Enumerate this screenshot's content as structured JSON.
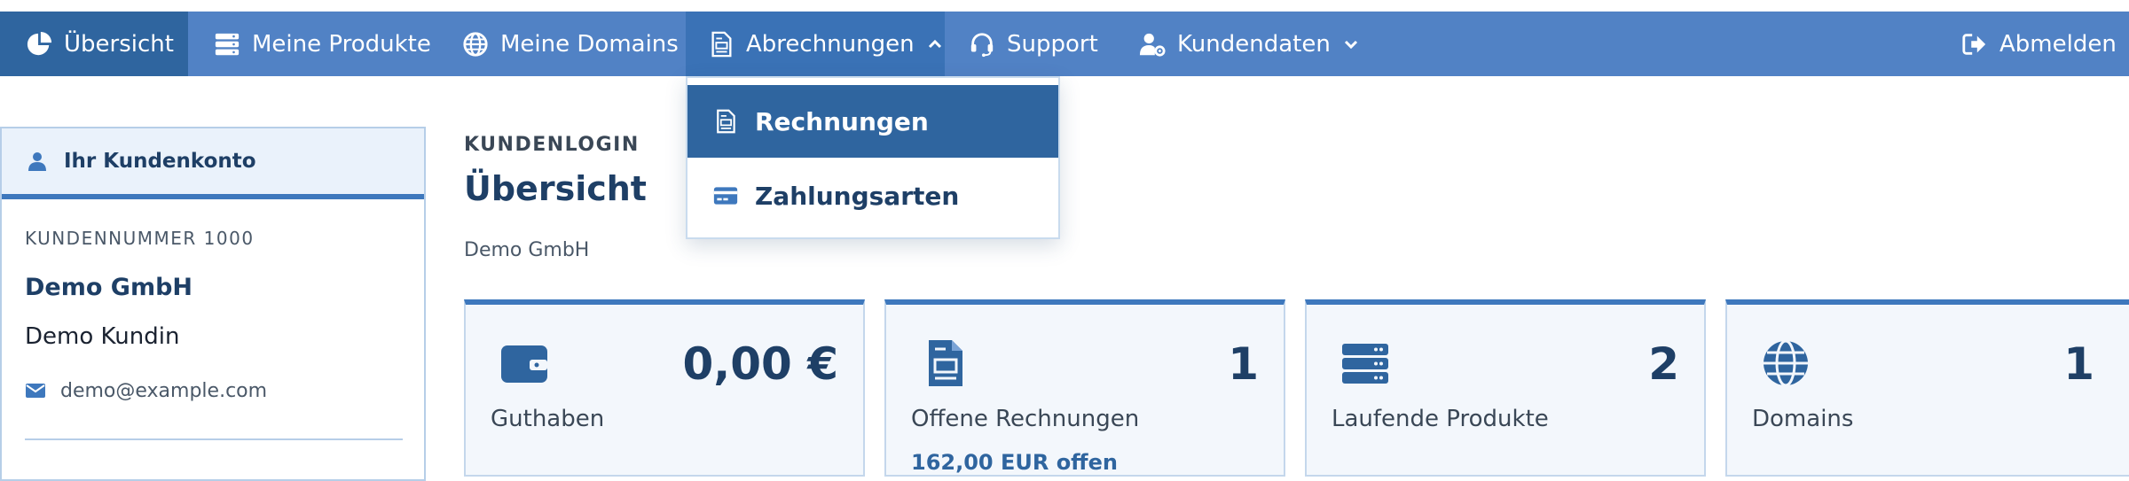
{
  "colors": {
    "nav_bg": "#5182c5",
    "nav_active": "#2f659f",
    "accent": "#3e78bd",
    "heading": "#1e3f66"
  },
  "nav": {
    "items": [
      {
        "label": "Übersicht",
        "icon": "pie-chart-icon"
      },
      {
        "label": "Meine Produkte",
        "icon": "server-icon"
      },
      {
        "label": "Meine Domains",
        "icon": "globe-icon"
      },
      {
        "label": "Abrechnungen",
        "icon": "invoice-icon"
      },
      {
        "label": "Support",
        "icon": "headset-icon"
      },
      {
        "label": "Kundendaten",
        "icon": "user-gear-icon"
      }
    ],
    "logout": {
      "label": "Abmelden",
      "icon": "sign-out-icon"
    }
  },
  "dropdown": {
    "items": [
      {
        "label": "Rechnungen",
        "icon": "invoice-icon"
      },
      {
        "label": "Zahlungsarten",
        "icon": "credit-card-icon"
      }
    ]
  },
  "sidebar": {
    "header": "Ihr Kundenkonto",
    "customer_number": "KUNDENNUMMER 1000",
    "company": "Demo GmbH",
    "person": "Demo Kundin",
    "email": "demo@example.com"
  },
  "main": {
    "overline": "KUNDENLOGIN",
    "title": "Übersicht",
    "subtitle": "Demo GmbH",
    "cards": [
      {
        "value": "0,00 €",
        "label": "Guthaben",
        "icon": "wallet-icon"
      },
      {
        "value": "1",
        "label": "Offene Rechnungen",
        "extra": "162,00 EUR offen",
        "icon": "invoice-icon"
      },
      {
        "value": "2",
        "label": "Laufende Produkte",
        "icon": "server-icon"
      },
      {
        "value": "1",
        "label": "Domains",
        "icon": "globe-icon"
      }
    ]
  }
}
